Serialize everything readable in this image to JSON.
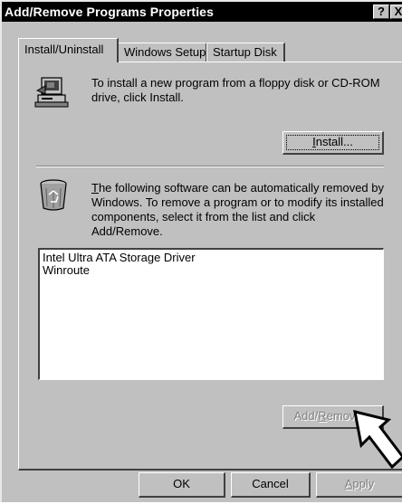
{
  "window": {
    "title": "Add/Remove Programs Properties",
    "help_glyph": "?",
    "close_glyph": "X"
  },
  "tabs": [
    {
      "label": "Install/Uninstall",
      "active": true
    },
    {
      "label": "Windows Setup",
      "active": false
    },
    {
      "label": "Startup Disk",
      "active": false
    }
  ],
  "install": {
    "description_line1": "To install a new program from a floppy disk or CD-ROM",
    "description_line2": "drive, click Install.",
    "button_label_pre": "I",
    "button_label_post": "nstall...",
    "icon": "computer-install-icon"
  },
  "uninstall": {
    "mnemonic": "T",
    "line1_rest": "he following software can be automatically removed by",
    "line2": "Windows. To remove a program or to modify its installed",
    "line3": "components, select it from the list and click",
    "line4": "Add/Remove.",
    "icon": "recycle-bin-icon",
    "programs": [
      "Intel Ultra ATA Storage Driver",
      "Winroute"
    ],
    "button_label_pre": "Add/",
    "button_label_mn": "R",
    "button_label_post": "emove..."
  },
  "footer": {
    "ok": "OK",
    "cancel": "Cancel",
    "apply_mn": "A",
    "apply_rest": "pply"
  }
}
